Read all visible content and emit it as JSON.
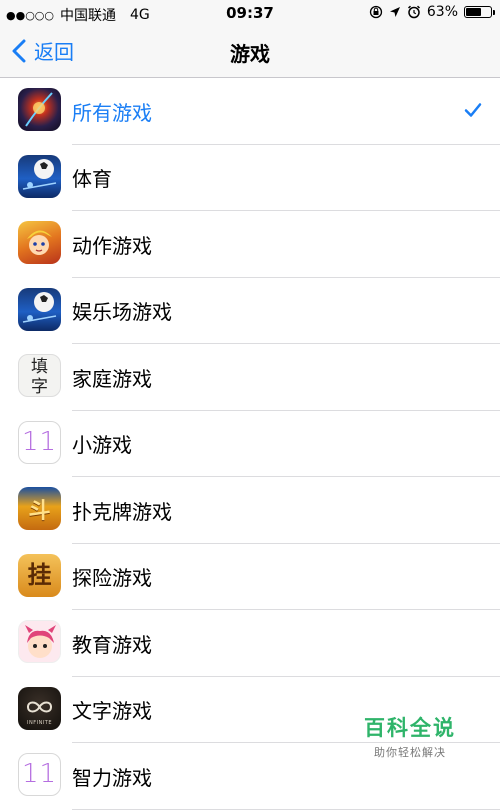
{
  "status": {
    "carrier": "中国联通",
    "network": "4G",
    "time": "09:37",
    "battery": "63%",
    "battery_level": 0.63
  },
  "nav": {
    "back_label": "返回",
    "title": "游戏"
  },
  "categories": [
    {
      "label": "所有游戏",
      "selected": true,
      "icon": "all-games-icon"
    },
    {
      "label": "体育",
      "selected": false,
      "icon": "sports-icon"
    },
    {
      "label": "动作游戏",
      "selected": false,
      "icon": "action-games-icon"
    },
    {
      "label": "娱乐场游戏",
      "selected": false,
      "icon": "casino-games-icon"
    },
    {
      "label": "家庭游戏",
      "selected": false,
      "icon": "family-games-icon"
    },
    {
      "label": "小游戏",
      "selected": false,
      "icon": "mini-games-icon"
    },
    {
      "label": "扑克牌游戏",
      "selected": false,
      "icon": "card-games-icon"
    },
    {
      "label": "探险游戏",
      "selected": false,
      "icon": "adventure-games-icon"
    },
    {
      "label": "教育游戏",
      "selected": false,
      "icon": "educational-games-icon"
    },
    {
      "label": "文字游戏",
      "selected": false,
      "icon": "word-games-icon"
    },
    {
      "label": "智力游戏",
      "selected": false,
      "icon": "puzzle-games-icon"
    }
  ],
  "icon_text": {
    "family": "填字",
    "ios11": "11",
    "card": "斗",
    "adventure": "挂",
    "word": "INFINITE"
  },
  "watermark": {
    "title": "百科全说",
    "subtitle": "助你轻松解决"
  },
  "colors": {
    "accent": "#1a7ef5",
    "watermark": "#2fb46a"
  }
}
